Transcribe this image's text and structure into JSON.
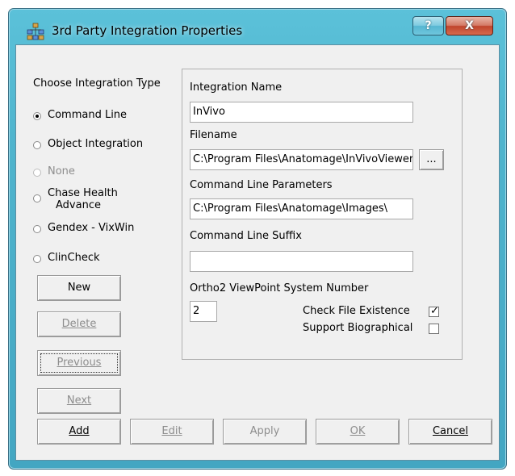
{
  "window": {
    "title": "3rd Party Integration Properties",
    "help_label": "?",
    "close_label": "X",
    "icon": "network-people-icon"
  },
  "integration_type": {
    "heading": "Choose Integration Type",
    "options": [
      {
        "label": "Command Line",
        "selected": true,
        "enabled": true
      },
      {
        "label": "Object Integration",
        "selected": false,
        "enabled": true
      },
      {
        "label": "None",
        "selected": false,
        "enabled": false
      },
      {
        "label": "Chase Health Advance",
        "selected": false,
        "enabled": true
      },
      {
        "label": "Gendex - VixWin",
        "selected": false,
        "enabled": true
      },
      {
        "label": "ClinCheck",
        "selected": false,
        "enabled": true
      }
    ],
    "chase_line1": "Chase Health",
    "chase_line2": "Advance"
  },
  "side_buttons": {
    "new": "New",
    "delete": "Delete",
    "previous": "Previous",
    "next": "Next"
  },
  "form": {
    "integration_name_label": "Integration Name",
    "integration_name_value": "InVivo",
    "filename_label": "Filename",
    "filename_value": "C:\\Program Files\\Anatomage\\InVivoViewer",
    "browse_label": "...",
    "params_label": "Command Line Parameters",
    "params_value": "C:\\Program Files\\Anatomage\\Images\\",
    "suffix_label": "Command Line Suffix",
    "suffix_value": "",
    "ortho_label": "Ortho2 ViewPoint System Number",
    "ortho_value": "2",
    "check_file_label": "Check File Existence",
    "check_file_checked": true,
    "support_bio_label": "Support Biographical",
    "support_bio_checked": false
  },
  "bottom_buttons": {
    "add": "Add",
    "edit": "Edit",
    "apply": "Apply",
    "ok": "OK",
    "cancel": "Cancel"
  },
  "colors": {
    "frame": "#4fb4cd",
    "close_button": "#c0452c",
    "dialog_bg": "#f0f0f0"
  }
}
